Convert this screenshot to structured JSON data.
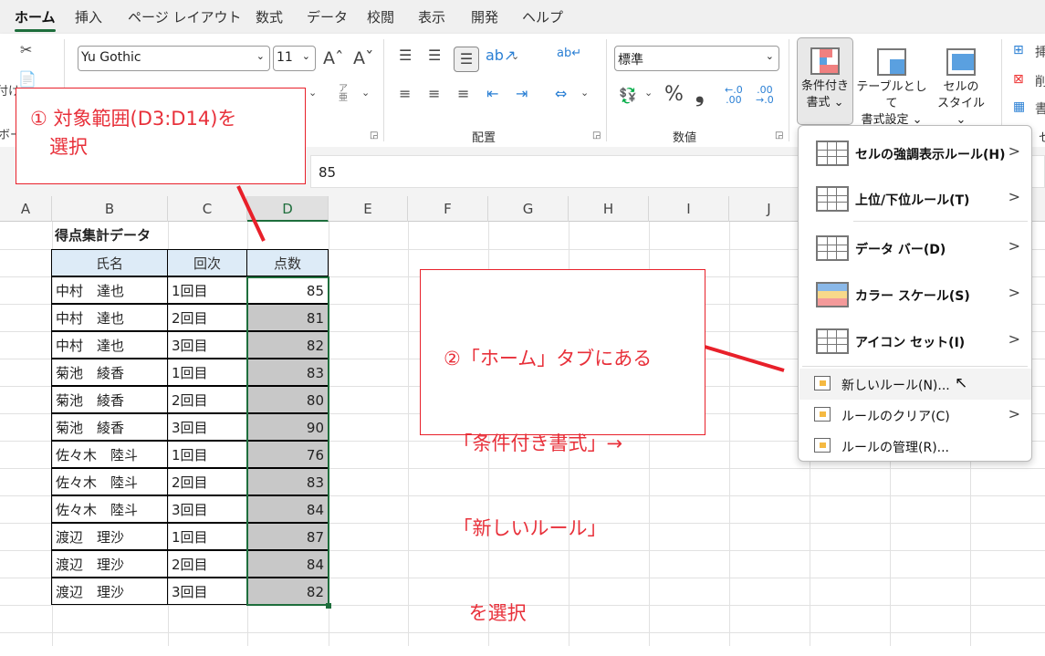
{
  "tabs": [
    "ホーム",
    "挿入",
    "ページ レイアウト",
    "数式",
    "データ",
    "校閲",
    "表示",
    "開発",
    "ヘルプ"
  ],
  "ribbon": {
    "clipboard_partial_label": "付け",
    "clipboard_group_partial": "ボー",
    "font_name": "Yu Gothic",
    "font_size": "11",
    "furigana_icon": "ア亜",
    "alignment_group": "配置",
    "number_format": "標準",
    "number_group": "数値",
    "percent": "%",
    "comma": "❟",
    "inc_decimal": "←.0\n.00",
    "dec_decimal": ".00\n→.0",
    "cond_format": [
      "条件付き",
      "書式 ⌄"
    ],
    "format_table": [
      "テーブルとして",
      "書式設定 ⌄"
    ],
    "cell_style": [
      "セルの",
      "スタイル ⌄"
    ],
    "cells_partial": [
      "挿",
      "削",
      "書"
    ],
    "cells_group_partial": "セ"
  },
  "formula_bar": {
    "value": "85"
  },
  "columns": [
    "A",
    "B",
    "C",
    "D",
    "E",
    "F",
    "G",
    "H",
    "I",
    "J"
  ],
  "sheet": {
    "title": "得点集計データ",
    "headers": [
      "氏名",
      "回次",
      "点数"
    ],
    "rows": [
      [
        "中村　達也",
        "1回目",
        "85"
      ],
      [
        "中村　達也",
        "2回目",
        "81"
      ],
      [
        "中村　達也",
        "3回目",
        "82"
      ],
      [
        "菊池　綾香",
        "1回目",
        "83"
      ],
      [
        "菊池　綾香",
        "2回目",
        "80"
      ],
      [
        "菊池　綾香",
        "3回目",
        "90"
      ],
      [
        "佐々木　陸斗",
        "1回目",
        "76"
      ],
      [
        "佐々木　陸斗",
        "2回目",
        "83"
      ],
      [
        "佐々木　陸斗",
        "3回目",
        "84"
      ],
      [
        "渡辺　理沙",
        "1回目",
        "87"
      ],
      [
        "渡辺　理沙",
        "2回目",
        "84"
      ],
      [
        "渡辺　理沙",
        "3回目",
        "82"
      ]
    ]
  },
  "menu": {
    "items": [
      {
        "label": "セルの強調表示ルール(H)",
        "icon": "highlight-rules-icon"
      },
      {
        "label": "上位/下位ルール(T)",
        "icon": "top-bottom-rules-icon"
      },
      {
        "label": "データ バー(D)",
        "icon": "data-bar-icon"
      },
      {
        "label": "カラー スケール(S)",
        "icon": "color-scale-icon"
      },
      {
        "label": "アイコン セット(I)",
        "icon": "icon-set-icon"
      }
    ],
    "new_rule": "新しいルール(N)...",
    "clear_rules": "ルールのクリア(C)",
    "manage_rules": "ルールの管理(R)..."
  },
  "callouts": {
    "step1": [
      "① 対象範囲(D3:D14)を",
      "　選択"
    ],
    "step2": [
      "②「ホーム」タブにある",
      "　「条件付き書式」→",
      "　「新しいルール」",
      "　 を選択"
    ]
  },
  "colors": {
    "accent": "#1e6e3c",
    "callout": "#e8202a",
    "header_fill": "#ddebf7",
    "selection_fill": "#c8c8c8"
  }
}
